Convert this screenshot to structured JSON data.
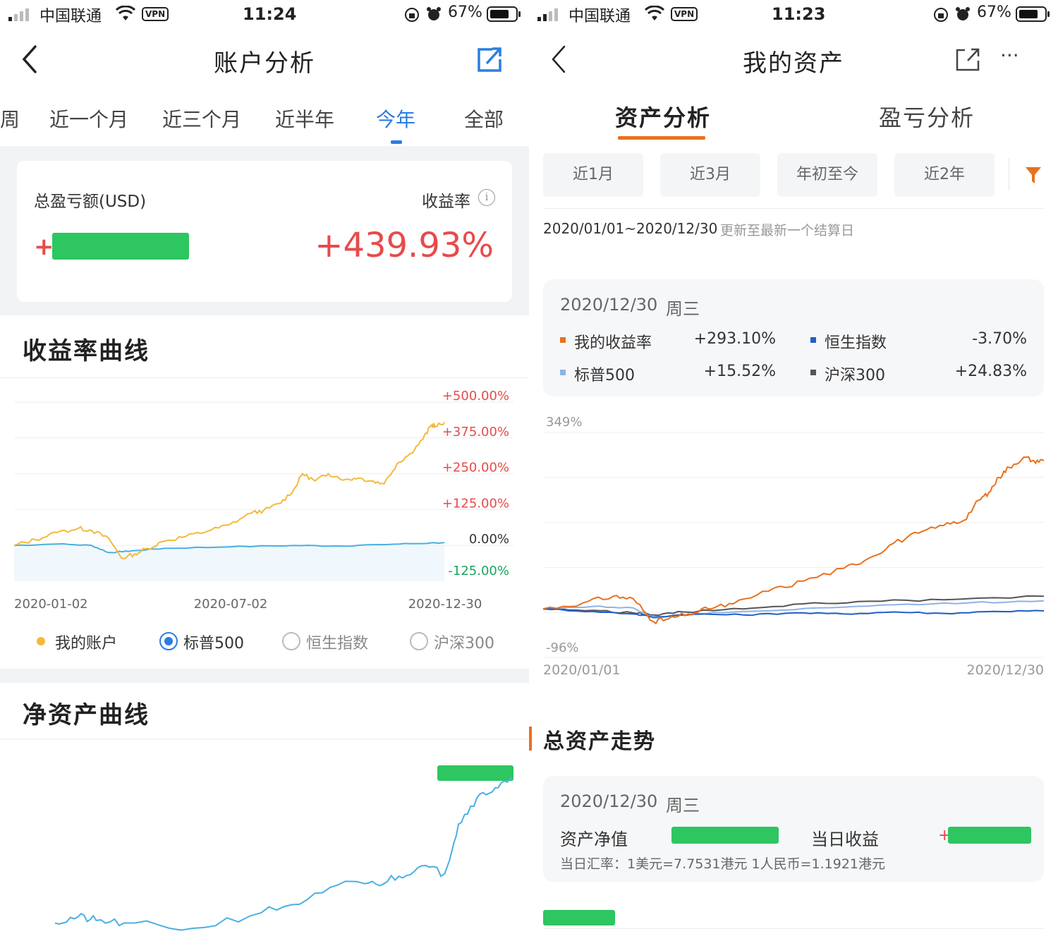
{
  "left": {
    "status": {
      "carrier": "中国联通",
      "vpn": "VPN",
      "time": "11:24",
      "battery": "67%"
    },
    "nav": {
      "title": "账户分析",
      "back_icon": "chevron-left-icon",
      "share_icon": "share-icon"
    },
    "tabs": [
      {
        "label": "周"
      },
      {
        "label": "近一个月"
      },
      {
        "label": "近三个月"
      },
      {
        "label": "近半年"
      },
      {
        "label": "今年",
        "active": true
      },
      {
        "label": "全部"
      }
    ],
    "summary": {
      "pnl_label": "总盈亏额(USD)",
      "pnl_sign": "+",
      "rate_label": "收益率",
      "rate_value": "+439.93%",
      "info_icon": "info-icon"
    },
    "return_curve": {
      "title": "收益率曲线"
    },
    "legend": [
      {
        "label": "我的账户",
        "type": "dot",
        "color": "#f5b93a"
      },
      {
        "label": "标普500",
        "type": "radio",
        "checked": true
      },
      {
        "label": "恒生指数",
        "type": "radio",
        "checked": false
      },
      {
        "label": "沪深300",
        "type": "radio",
        "checked": false
      }
    ],
    "net_asset_curve": {
      "title": "净资产曲线"
    }
  },
  "right": {
    "status": {
      "carrier": "中国联通",
      "vpn": "VPN",
      "time": "11:23",
      "battery": "67%"
    },
    "nav": {
      "title": "我的资产",
      "back_icon": "chevron-left-icon",
      "share_icon": "share-icon",
      "more_label": "···"
    },
    "tabs": [
      {
        "label": "资产分析",
        "active": true
      },
      {
        "label": "盈亏分析"
      }
    ],
    "chips": [
      {
        "label": "近1月"
      },
      {
        "label": "近3月"
      },
      {
        "label": "年初至今"
      },
      {
        "label": "近2年"
      }
    ],
    "filter_icon": "filter-icon",
    "range": {
      "dates": "2020/01/01~2020/12/30",
      "note": "更新至最新一个结算日"
    },
    "tooltip": {
      "date": "2020/12/30",
      "weekday": "周三",
      "items": [
        {
          "label": "我的收益率",
          "value": "+293.10%",
          "color": "#e8711f",
          "tone": "red"
        },
        {
          "label": "恒生指数",
          "value": "-3.70%",
          "color": "#1f5fc8",
          "tone": "green"
        },
        {
          "label": "标普500",
          "value": "+15.52%",
          "color": "#8fb3e6",
          "tone": "red"
        },
        {
          "label": "沪深300",
          "value": "+24.83%",
          "color": "#555555",
          "tone": "red"
        }
      ]
    },
    "total_assets": {
      "title": "总资产走势",
      "date": "2020/12/30",
      "weekday": "周三",
      "nav_label": "资产净值",
      "daily_label": "当日收益",
      "daily_sign": "+",
      "fx_note": "当日汇率：1美元=7.7531港元  1人民币=1.1921港元"
    }
  },
  "chart_data": [
    {
      "type": "line",
      "y_tick_labels": [
        "+500.00%",
        "+375.00%",
        "+250.00%",
        "+125.00%",
        "0.00%",
        "-125.00%"
      ],
      "x_tick_labels": [
        "2020-01-02",
        "2020-07-02",
        "2020-12-30"
      ],
      "ylim": [
        -125,
        500
      ],
      "grid": true,
      "series": [
        {
          "name": "我的账户",
          "color": "#f5b93a",
          "points": [
            [
              0,
              0
            ],
            [
              5,
              20
            ],
            [
              10,
              45
            ],
            [
              15,
              60
            ],
            [
              18,
              52
            ],
            [
              22,
              25
            ],
            [
              25,
              -45
            ],
            [
              28,
              -30
            ],
            [
              31,
              -10
            ],
            [
              35,
              15
            ],
            [
              40,
              32
            ],
            [
              45,
              50
            ],
            [
              50,
              72
            ],
            [
              55,
              112
            ],
            [
              58,
              122
            ],
            [
              62,
              148
            ],
            [
              65,
              195
            ],
            [
              67,
              250
            ],
            [
              70,
              225
            ],
            [
              73,
              250
            ],
            [
              77,
              230
            ],
            [
              80,
              235
            ],
            [
              83,
              225
            ],
            [
              86,
              215
            ],
            [
              89,
              285
            ],
            [
              92,
              320
            ],
            [
              95,
              370
            ],
            [
              97,
              420
            ],
            [
              98,
              415
            ],
            [
              100,
              430
            ]
          ]
        },
        {
          "name": "标普500",
          "color": "#4ab0e0",
          "points": [
            [
              0,
              0
            ],
            [
              10,
              5
            ],
            [
              18,
              0
            ],
            [
              22,
              -25
            ],
            [
              25,
              -22
            ],
            [
              28,
              -18
            ],
            [
              35,
              -10
            ],
            [
              50,
              -5
            ],
            [
              65,
              0
            ],
            [
              75,
              -2
            ],
            [
              85,
              3
            ],
            [
              92,
              6
            ],
            [
              100,
              10
            ]
          ]
        }
      ]
    },
    {
      "type": "line",
      "ylabel": "",
      "series": [
        {
          "name": "",
          "color": "#4ab0e0",
          "points": [
            [
              0,
              0
            ],
            [
              5,
              12
            ],
            [
              9,
              5
            ],
            [
              15,
              0
            ],
            [
              30,
              -10
            ],
            [
              45,
              20
            ],
            [
              55,
              45
            ],
            [
              65,
              80
            ],
            [
              70,
              75
            ],
            [
              75,
              90
            ],
            [
              80,
              110
            ],
            [
              85,
              95
            ],
            [
              88,
              190
            ],
            [
              92,
              240
            ],
            [
              96,
              260
            ],
            [
              100,
              275
            ]
          ]
        }
      ]
    },
    {
      "type": "line",
      "y_tick_labels": [
        "349%",
        "-96%"
      ],
      "x_tick_labels": [
        "2020/01/01",
        "2020/12/30"
      ],
      "ylim": [
        -96,
        349
      ],
      "grid": true,
      "series": [
        {
          "name": "我的收益率",
          "color": "#e8711f",
          "points": [
            [
              0,
              0
            ],
            [
              8,
              12
            ],
            [
              14,
              25
            ],
            [
              18,
              20
            ],
            [
              22,
              -25
            ],
            [
              25,
              -20
            ],
            [
              29,
              -10
            ],
            [
              33,
              0
            ],
            [
              38,
              10
            ],
            [
              45,
              35
            ],
            [
              52,
              55
            ],
            [
              60,
              80
            ],
            [
              65,
              100
            ],
            [
              70,
              130
            ],
            [
              75,
              150
            ],
            [
              80,
              165
            ],
            [
              84,
              175
            ],
            [
              87,
              215
            ],
            [
              89,
              230
            ],
            [
              91,
              260
            ],
            [
              93,
              280
            ],
            [
              96,
              300
            ],
            [
              98,
              293
            ],
            [
              100,
              293
            ]
          ]
        },
        {
          "name": "恒生指数",
          "color": "#1f5fc8",
          "points": [
            [
              0,
              0
            ],
            [
              10,
              -5
            ],
            [
              18,
              -10
            ],
            [
              22,
              -16
            ],
            [
              30,
              -10
            ],
            [
              40,
              -12
            ],
            [
              50,
              -8
            ],
            [
              60,
              -10
            ],
            [
              70,
              -6
            ],
            [
              80,
              -9
            ],
            [
              90,
              -5
            ],
            [
              100,
              -4
            ]
          ]
        },
        {
          "name": "标普500",
          "color": "#8fb3e6",
          "points": [
            [
              0,
              0
            ],
            [
              10,
              5
            ],
            [
              18,
              2
            ],
            [
              22,
              -18
            ],
            [
              28,
              -12
            ],
            [
              40,
              -5
            ],
            [
              55,
              2
            ],
            [
              70,
              8
            ],
            [
              85,
              12
            ],
            [
              100,
              16
            ]
          ]
        },
        {
          "name": "沪深300",
          "color": "#555555",
          "points": [
            [
              0,
              0
            ],
            [
              10,
              -3
            ],
            [
              18,
              -8
            ],
            [
              22,
              -12
            ],
            [
              28,
              -6
            ],
            [
              40,
              0
            ],
            [
              52,
              10
            ],
            [
              65,
              15
            ],
            [
              80,
              18
            ],
            [
              100,
              25
            ]
          ]
        }
      ]
    }
  ]
}
